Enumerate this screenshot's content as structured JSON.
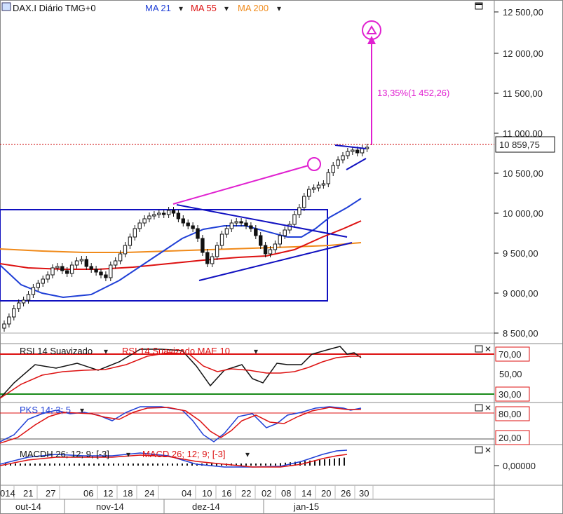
{
  "header": {
    "symbol": "DAX.I Diário TMG+0",
    "ma21": "MA 21",
    "ma55": "MA 55",
    "ma200": "MA 200",
    "arrow": "▾"
  },
  "colors": {
    "candle": "#111111",
    "ma21": "#1f3fd6",
    "ma55": "#dd1111",
    "ma200": "#f08a1a",
    "target": "#e020d0",
    "box": "#1010c0",
    "priceLine": "#cc0000",
    "rsi": "#111111",
    "rsiAvg": "#dd1111",
    "pks": "#1f3fd6",
    "pksSig": "#dd1111",
    "macd": "#1f3fd6",
    "macdSig": "#dd1111",
    "band70": "#dd1111",
    "band30": "#1a8a1a"
  },
  "price_panel": {
    "y_ticks": [
      "12 500,00",
      "12 000,00",
      "11 500,00",
      "11 000,00",
      "10 500,00",
      "10 000,00",
      "9 500,00",
      "9 000,00",
      "8 500,00"
    ],
    "last_price": "10 859,75",
    "target_label": "13,35%(1 452,26)"
  },
  "rsi_panel": {
    "title": "RSI 14 Suavizado",
    "avg_title": "RSI 14 Suavizado MAE 10",
    "levels": [
      "70,00",
      "50,00",
      "30,00"
    ]
  },
  "pks_panel": {
    "title": "PKS 14; 3; 5",
    "levels": [
      "80,00",
      "20,00"
    ]
  },
  "macd_panel": {
    "title": "MACDH 26; 12; 9; [-3]",
    "sig_title": "MACD 26; 12; 9; [-3]",
    "levels": [
      "0,00000"
    ]
  },
  "x_axis": {
    "days": [
      "014",
      "21",
      "27",
      "06",
      "12",
      "18",
      "24",
      "04",
      "10",
      "16",
      "22",
      "02",
      "08",
      "14",
      "20",
      "26",
      "30"
    ],
    "months": [
      "out-14",
      "nov-14",
      "dez-14",
      "jan-15"
    ]
  },
  "chart_data": {
    "type": "line",
    "title": "DAX.I Diário TMG+0",
    "price_ylim": [
      8400,
      12700
    ],
    "series": [
      {
        "name": "DAX.I",
        "kind": "candlestick"
      },
      {
        "name": "MA 21",
        "values": [
          8950,
          9010,
          9100,
          9250,
          9480,
          9700,
          9860,
          9900,
          9880,
          9720,
          9700,
          10000,
          10200
        ]
      },
      {
        "name": "MA 55",
        "values": [
          9470,
          9300,
          9290,
          9300,
          9350,
          9400,
          9450,
          9500,
          9530,
          9560,
          9650,
          9780,
          9900
        ]
      },
      {
        "name": "MA 200",
        "values": [
          9560,
          9520,
          9510,
          9510,
          9520,
          9530,
          9545,
          9560,
          9575,
          9590,
          9610,
          9625,
          9640
        ]
      }
    ],
    "target_pct": "13,35%",
    "target_points": "1 452,26",
    "last_close": 10859.75,
    "rsi_levels": [
      70,
      50,
      30
    ],
    "pks_levels": [
      80,
      20
    ],
    "macd_zero": 0
  }
}
